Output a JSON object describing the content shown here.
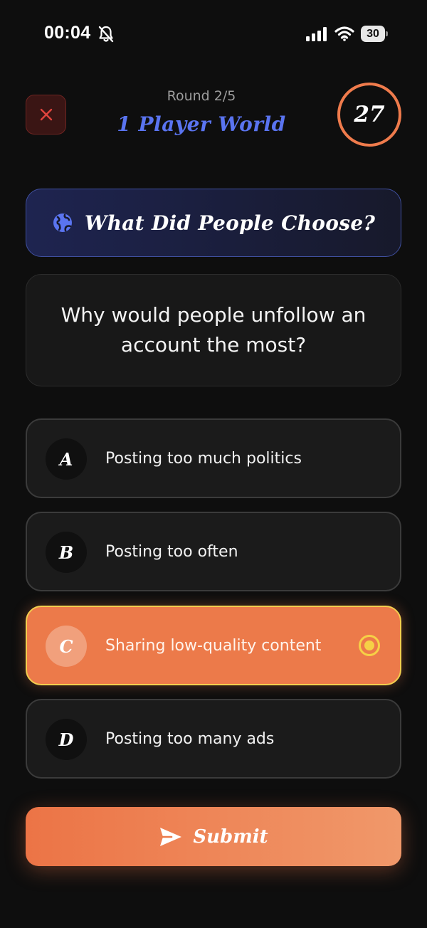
{
  "status_bar": {
    "time": "00:04",
    "battery": "30"
  },
  "header": {
    "round": "Round 2/5",
    "mode": "1 Player World",
    "timer": "27"
  },
  "category": {
    "icon": "globe-icon",
    "title": "What Did People Choose?"
  },
  "question": {
    "text": "Why would people unfollow an account the most?"
  },
  "options": [
    {
      "letter": "A",
      "text": "Posting too much politics",
      "selected": false
    },
    {
      "letter": "B",
      "text": "Posting too often",
      "selected": false
    },
    {
      "letter": "C",
      "text": "Sharing low-quality content",
      "selected": true
    },
    {
      "letter": "D",
      "text": "Posting too many ads",
      "selected": false
    }
  ],
  "submit": {
    "label": "Submit",
    "icon": "send-icon"
  },
  "colors": {
    "accent_orange": "#ec7a4a",
    "selected_border": "#f3ce4e",
    "mode_blue": "#5a74f0",
    "close_red": "#e0443d"
  }
}
